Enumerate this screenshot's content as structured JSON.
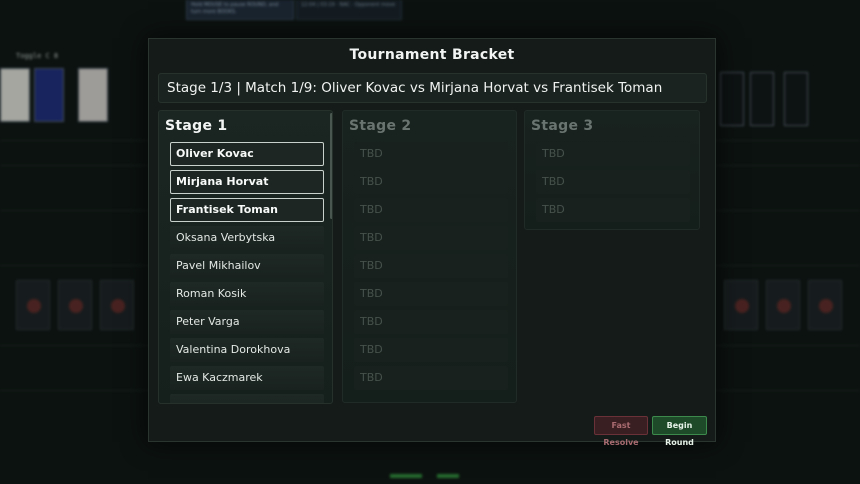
{
  "background": {
    "note_1": "Hold MOUSE to pause ROUND, and turn more BOOKS.",
    "note_2": "12:04 | 03:19 · NAC · Opponent move",
    "toggle_label": "Toggle C 8"
  },
  "modal": {
    "title": "Tournament Bracket",
    "match_info": "Stage 1/3 | Match 1/9: Oliver Kovac vs Mirjana Horvat vs Frantisek Toman"
  },
  "stages": [
    {
      "title": "Stage 1",
      "entries": [
        {
          "name": "Oliver Kovac",
          "active": true
        },
        {
          "name": "Mirjana Horvat",
          "active": true
        },
        {
          "name": "Frantisek Toman",
          "active": true
        },
        {
          "name": "Oksana Verbytska",
          "active": false
        },
        {
          "name": "Pavel Mikhailov",
          "active": false
        },
        {
          "name": "Roman Kosik",
          "active": false
        },
        {
          "name": "Peter Varga",
          "active": false
        },
        {
          "name": "Valentina Dorokhova",
          "active": false
        },
        {
          "name": "Ewa Kaczmarek",
          "active": false
        },
        {
          "name": "",
          "active": false
        }
      ]
    },
    {
      "title": "Stage 2",
      "entries": [
        "TBD",
        "TBD",
        "TBD",
        "TBD",
        "TBD",
        "TBD",
        "TBD",
        "TBD",
        "TBD"
      ]
    },
    {
      "title": "Stage 3",
      "entries": [
        "TBD",
        "TBD",
        "TBD"
      ]
    }
  ],
  "buttons": {
    "fast_resolve": "Fast Resolve",
    "begin_round": "Begin Round"
  },
  "colors": {
    "accent_green": "#3c8a4c",
    "danger_red": "#6a3238",
    "panel_bg": "#141b18"
  }
}
